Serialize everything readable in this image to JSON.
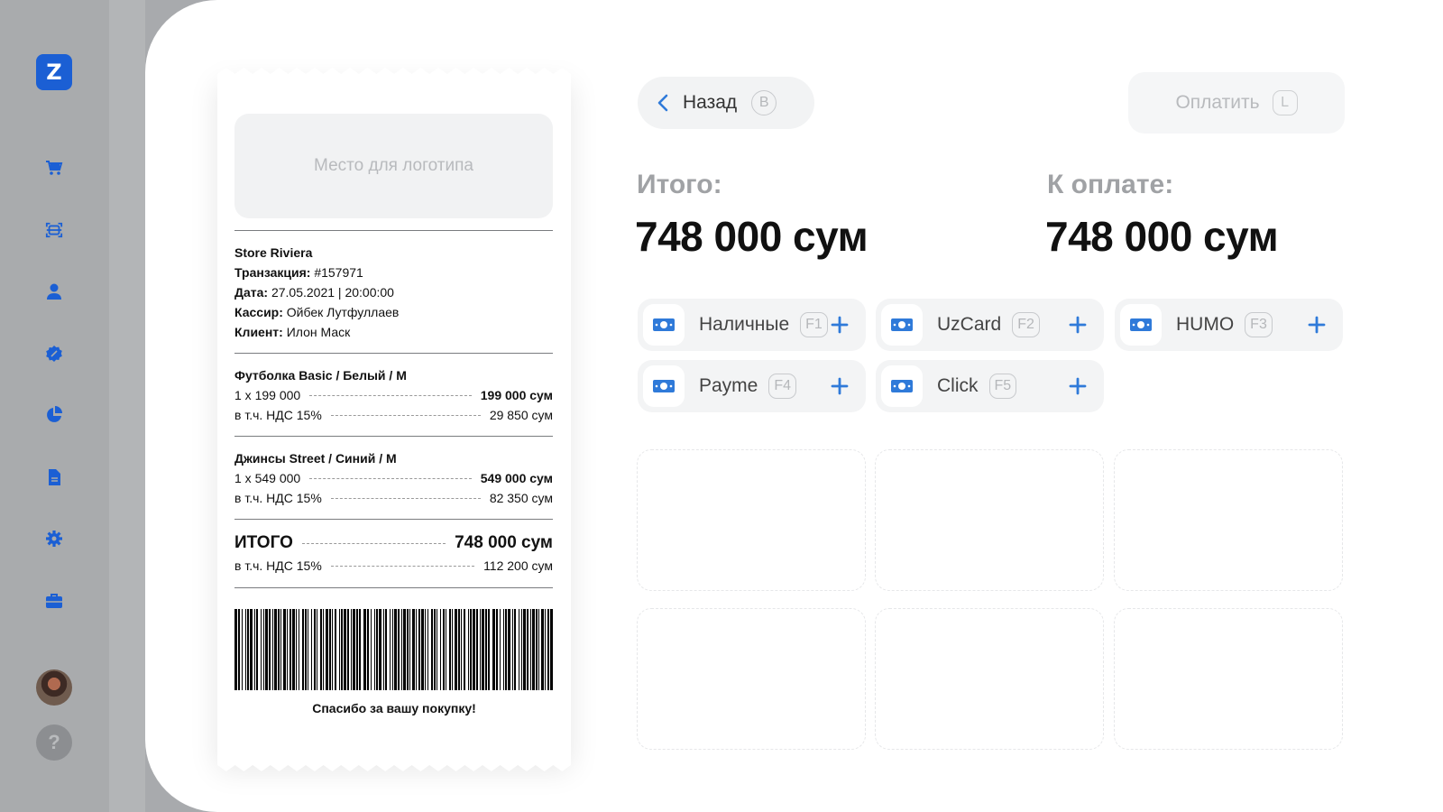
{
  "sidebar": {
    "logo_letter": "Z",
    "brand_color": "#1b5fd4",
    "items": [
      {
        "icon": "cart-icon"
      },
      {
        "icon": "scan-icon"
      },
      {
        "icon": "user-icon"
      },
      {
        "icon": "discount-badge-icon"
      },
      {
        "icon": "pie-chart-icon"
      },
      {
        "icon": "document-icon"
      },
      {
        "icon": "settings-gear-icon"
      },
      {
        "icon": "briefcase-icon"
      }
    ],
    "help_label": "?"
  },
  "receipt": {
    "logo_placeholder": "Место для логотипа",
    "store": "Store Riviera",
    "transaction_label": "Транзакция:",
    "transaction_value": "#157971",
    "date_label": "Дата:",
    "date_value": "27.05.2021 | 20:00:00",
    "cashier_label": "Кассир:",
    "cashier_value": "Ойбек Лутфуллаев",
    "client_label": "Клиент:",
    "client_value": "Илон Маск",
    "items": [
      {
        "title": "Футболка Basic / Белый / M",
        "qty_line": "1 x 199 000",
        "total": "199 000 сум",
        "vat_label": "в т.ч. НДС 15%",
        "vat_value": "29 850 сум"
      },
      {
        "title": "Джинсы Street / Синий / M",
        "qty_line": "1 x 549 000",
        "total": "549 000 сум",
        "vat_label": "в т.ч. НДС 15%",
        "vat_value": "82 350 сум"
      }
    ],
    "total_label": "ИТОГО",
    "total_value": "748 000 сум",
    "total_vat_label": "в т.ч. НДС 15%",
    "total_vat_value": "112 200 сум",
    "thanks": "Спасибо за вашу покупку!"
  },
  "header": {
    "back_label": "Назад",
    "back_key": "B",
    "pay_label": "Оплатить",
    "pay_key": "L"
  },
  "summary": {
    "total_label": "Итого:",
    "total_value": "748 000 сум",
    "due_label": "К оплате:",
    "due_value": "748 000 сум"
  },
  "payment_methods": [
    {
      "name": "Наличные",
      "key": "F1"
    },
    {
      "name": "UzCard",
      "key": "F2"
    },
    {
      "name": "HUMO",
      "key": "F3"
    },
    {
      "name": "Payme",
      "key": "F4"
    },
    {
      "name": "Click",
      "key": "F5"
    }
  ],
  "accent_color": "#2f7ad9"
}
